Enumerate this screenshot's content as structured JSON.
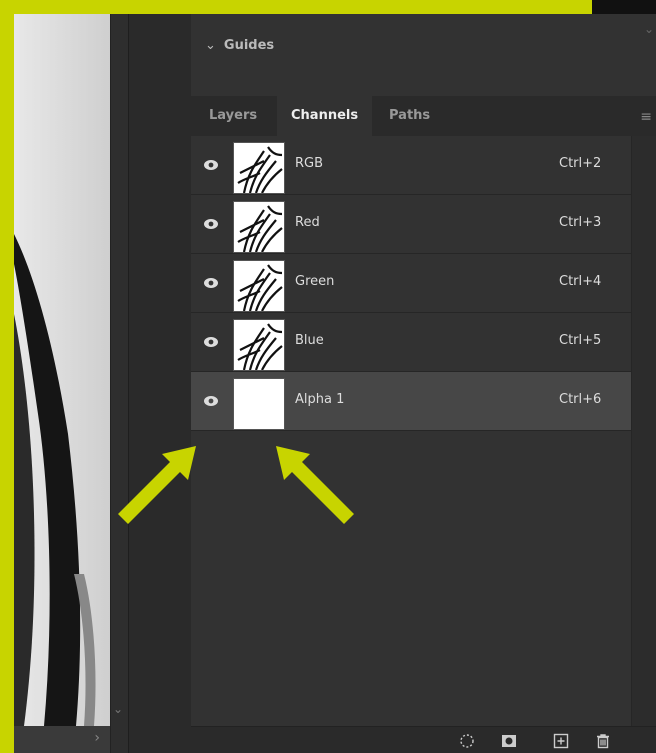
{
  "guides_panel": {
    "label": "Guides"
  },
  "tabs": [
    {
      "label": "Layers",
      "active": false
    },
    {
      "label": "Channels",
      "active": true
    },
    {
      "label": "Paths",
      "active": false
    }
  ],
  "channels": [
    {
      "name": "RGB",
      "shortcut": "Ctrl+2",
      "selected": false,
      "thumbnail": "zebra"
    },
    {
      "name": "Red",
      "shortcut": "Ctrl+3",
      "selected": false,
      "thumbnail": "zebra"
    },
    {
      "name": "Green",
      "shortcut": "Ctrl+4",
      "selected": false,
      "thumbnail": "zebra"
    },
    {
      "name": "Blue",
      "shortcut": "Ctrl+5",
      "selected": false,
      "thumbnail": "zebra"
    },
    {
      "name": "Alpha 1",
      "shortcut": "Ctrl+6",
      "selected": true,
      "thumbnail": "white"
    }
  ],
  "bottom_icons": [
    "load-selection-icon",
    "save-selection-mask-icon",
    "new-channel-icon",
    "trash-icon"
  ],
  "colors": {
    "annotation_arrow": "#c8d400",
    "frame_border": "#c8d400",
    "selected_row": "#474747",
    "panel_bg": "#323232"
  }
}
